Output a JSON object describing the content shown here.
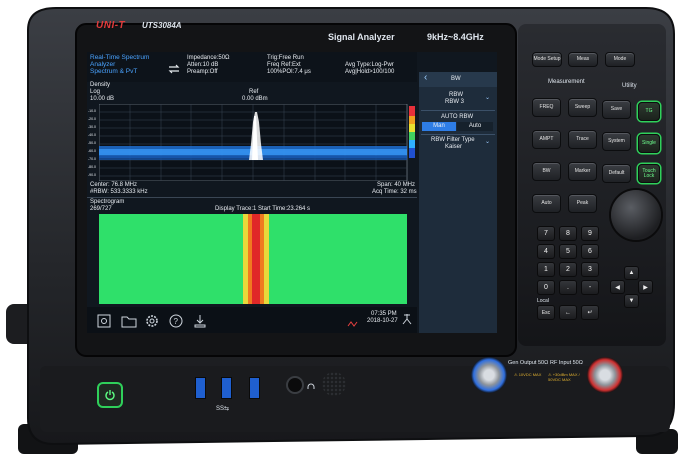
{
  "device": {
    "brand": "UNI-T",
    "model": "UTS3084A",
    "product": "Signal Analyzer",
    "range": "9kHz~8.4GHz"
  },
  "screen": {
    "mode_title": [
      "Real-Time Spectrum",
      "Analyzer",
      "Spectrum & PvT"
    ],
    "impedance": "Impedance:50Ω",
    "atten": "Atten:10 dB",
    "preamp": "Preamp:Off",
    "trig": "Trig:Free Run",
    "freq_ref": "Freq Ref:Ext",
    "poi": "100%POI:7.4 μs",
    "avg_type": "Avg Type:Log-Pwr",
    "avg_hold": "Avg|Hold>100/100",
    "density_label": "Density",
    "scale_type": "Log",
    "scale_div": "10.00 dB",
    "ref_label": "Ref",
    "ref_value": "0.00 dBm",
    "y_ticks": [
      "-10.0",
      "-20.0",
      "-30.0",
      "-40.0",
      "-50.0",
      "-60.0",
      "-70.0",
      "-80.0",
      "-90.0"
    ],
    "center": "Center: 76.8 MHz",
    "rbw_bottom": "#RBW: 533.3333 kHz",
    "span": "Span: 40 MHz",
    "acq_time": "Acq Time: 32 ms",
    "spectrogram_label": "Spectrogram",
    "trace_count": "269/727",
    "display_trace": "Display Trace:1  Start Time:23.264 s",
    "time": "07:35 PM",
    "date": "2018-10-27",
    "menu": {
      "back_glyph": "‹",
      "title": "BW",
      "rbw_label": "RBW",
      "rbw_value": "RBW  3",
      "auto_rbw_label": "AUTO RBW",
      "man_label": "Man",
      "auto_label": "Auto",
      "filter_label": "RBW Filter Type",
      "filter_value": "Kaiser"
    }
  },
  "front_panel": {
    "top_keys": [
      "Mode Setup",
      "Meas",
      "Mode"
    ],
    "measurement_label": "Measurement",
    "utility_label": "Utility",
    "meas_keys": [
      "FREQ",
      "Sweep",
      "AMPT",
      "Trace",
      "BW",
      "Marker",
      "Auto",
      "Peak"
    ],
    "utility_keys": [
      "Save",
      "System",
      "Default"
    ],
    "green_keys": [
      "TG",
      "Single",
      "Touch Lock"
    ],
    "numpad": [
      "7",
      "8",
      "9",
      "4",
      "5",
      "6",
      "1",
      "2",
      "3",
      "0",
      ".",
      "-"
    ],
    "local_label": "Local",
    "esc_label": "Esc",
    "gen_output": "Gen Output 50Ω",
    "gen_note": "⚠ 10VDC MAX",
    "rf_input": "RF Input 50Ω",
    "rf_note": "⚠ +30dBm MAX / 50VDC MAX",
    "usb_label": "SS⇆"
  }
}
